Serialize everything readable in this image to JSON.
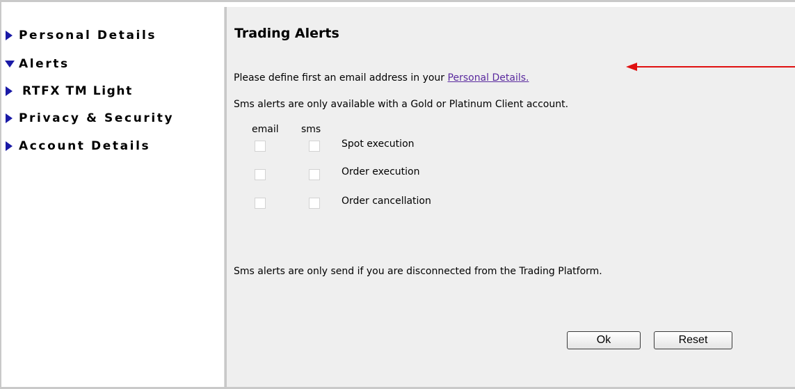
{
  "sidebar": {
    "items": [
      {
        "label": "Personal Details",
        "expanded": false
      },
      {
        "label": "Alerts",
        "expanded": true
      },
      {
        "label": "RTFX TM  Light",
        "expanded": false
      },
      {
        "label": "Privacy & Security",
        "expanded": false
      },
      {
        "label": "Account Details",
        "expanded": false
      }
    ]
  },
  "main": {
    "title": "Trading Alerts",
    "email_notice_prefix": "Please define first an email address in your ",
    "email_notice_link": "Personal Details.",
    "sms_notice": "Sms alerts are only available with a Gold or Platinum Client account.",
    "columns": {
      "email": "email",
      "sms": "sms"
    },
    "alerts": [
      {
        "label": "Spot execution",
        "email": false,
        "sms": false
      },
      {
        "label": "Order execution",
        "email": false,
        "sms": false
      },
      {
        "label": "Order cancellation",
        "email": false,
        "sms": false
      }
    ],
    "disconnect_notice": "Sms alerts are only send if you are disconnected from the Trading Platform.",
    "ok_label": "Ok",
    "reset_label": "Reset"
  },
  "colors": {
    "nav_triangle": "#1a1aa6",
    "panel_bg": "#efefef",
    "link": "#5a2a9e",
    "annotation_arrow": "#e01010"
  }
}
